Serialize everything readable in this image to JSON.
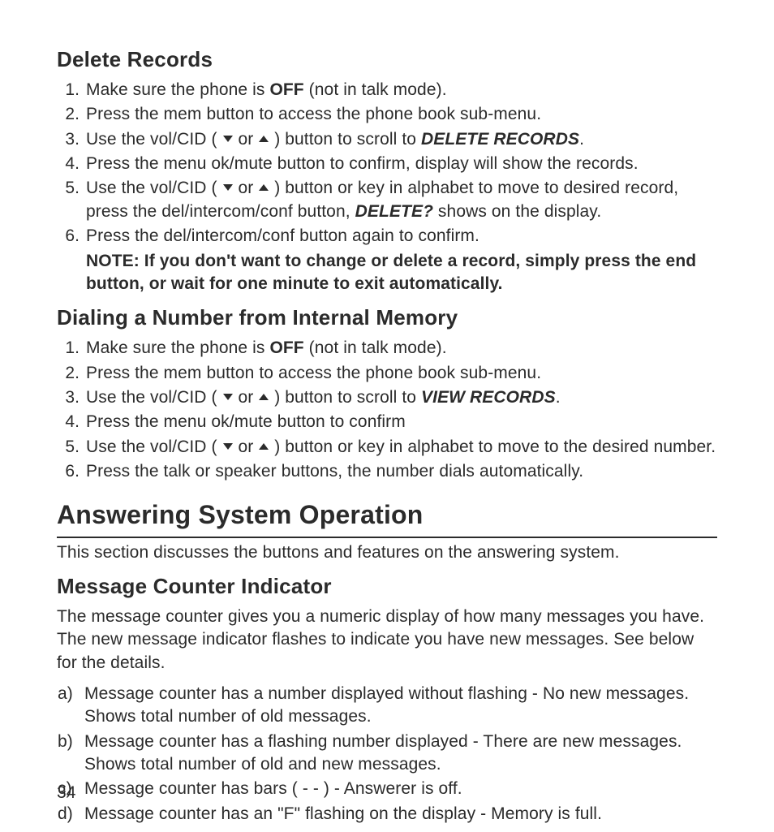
{
  "page_number": "34",
  "delete_records": {
    "heading": "Delete Records",
    "items": [
      {
        "pre": "Make sure the phone is ",
        "bold": "OFF",
        "post": " (not in talk mode)."
      },
      {
        "text": "Press the mem button to access the phone book sub-menu."
      },
      {
        "pre_arrows": "Use the vol/CID ( ",
        "mid_arrows": " or ",
        "post_arrows": " )  button to scroll to ",
        "bold_italic": "DELETE RECORDS",
        "post": "."
      },
      {
        "text": "Press the menu ok/mute  button to confirm, display will show the records."
      },
      {
        "pre_arrows": "Use the vol/CID ( ",
        "mid_arrows": " or ",
        "post_arrows": " )  button or key in alphabet to move to desired record, press the del/intercom/conf button, ",
        "bold_italic": "DELETE?",
        "post": " shows on the display."
      },
      {
        "text": "Press the del/intercom/conf button again to confirm.",
        "note": "NOTE: If you don't want to change or delete a record, simply press the end button, or wait for one minute to exit automatically."
      }
    ]
  },
  "dialing": {
    "heading": "Dialing a Number from Internal Memory",
    "items": [
      {
        "pre": "Make sure the phone is ",
        "bold": "OFF",
        "post": " (not in talk mode)."
      },
      {
        "text": "Press the mem button to access the phone book sub-menu."
      },
      {
        "pre_arrows": "Use the vol/CID ( ",
        "mid_arrows": " or ",
        "post_arrows": " )  button to scroll to  ",
        "bold_italic": "VIEW RECORDS",
        "post": "."
      },
      {
        "text": "Press the menu ok/mute  button to confirm"
      },
      {
        "pre_arrows": "Use the vol/CID ( ",
        "mid_arrows": " or ",
        "post_arrows": " )  button or key in alphabet to move to the desired number."
      },
      {
        "text": "Press the talk or speaker buttons, the number dials automatically."
      }
    ]
  },
  "answering": {
    "heading": "Answering System Operation",
    "intro": "This section discusses the buttons and features on the answering system."
  },
  "message_counter": {
    "heading": "Message Counter Indicator",
    "intro": "The message counter gives you a numeric display of how many messages you have. The new message indicator flashes to indicate you have new messages. See below for the details.",
    "items": [
      {
        "marker": "a)",
        "text": "Message counter has a number displayed without flashing - No new messages. Shows total number of old messages."
      },
      {
        "marker": "b)",
        "text": "Message counter has a flashing number displayed - There are new messages. Shows total number of old and new messages."
      },
      {
        "marker": "c)",
        "text": "Message counter has bars ( - - ) - Answerer is off."
      },
      {
        "marker": "d)",
        "text": "Message counter has an \"F\" flashing on the display - Memory is full."
      }
    ]
  }
}
